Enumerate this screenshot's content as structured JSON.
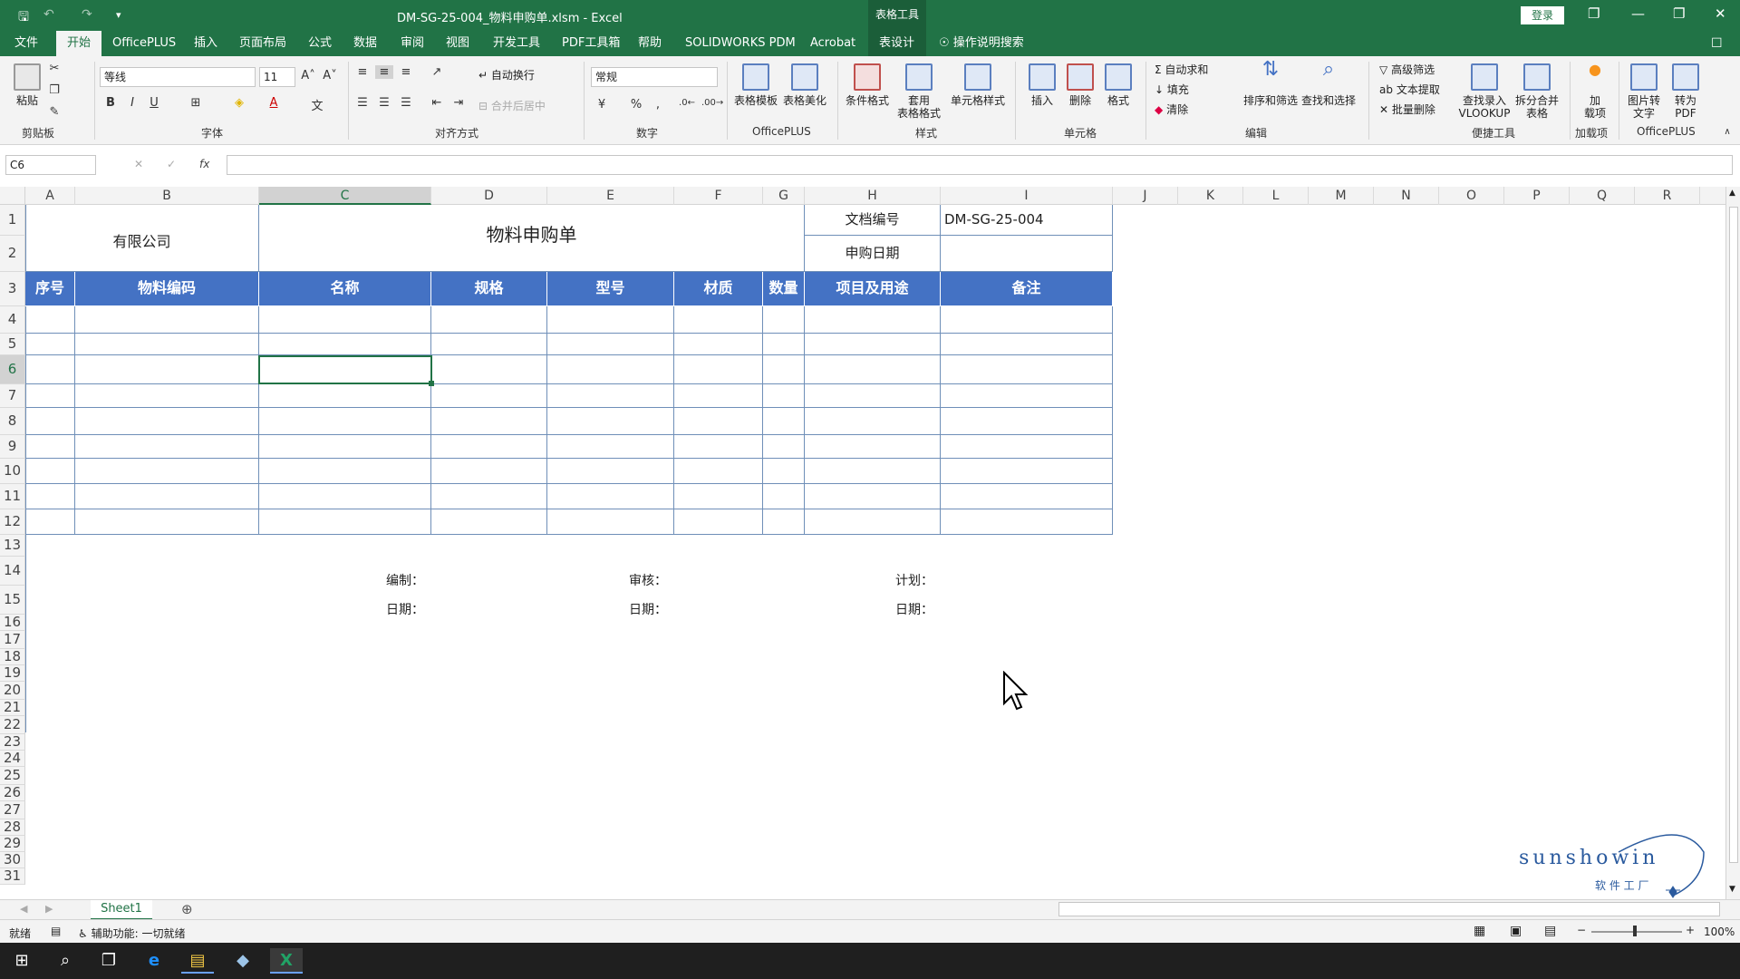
{
  "titlebar": {
    "doc_title": "DM-SG-25-004_物料申购单.xlsm  -  Excel",
    "context_tool": "表格工具",
    "login": "登录"
  },
  "tabs": [
    "文件",
    "开始",
    "OfficePLUS",
    "插入",
    "页面布局",
    "公式",
    "数据",
    "审阅",
    "视图",
    "开发工具",
    "PDF工具箱",
    "帮助",
    "SOLIDWORKS PDM",
    "Acrobat",
    "表设计"
  ],
  "active_tab": "开始",
  "search_tab": "操作说明搜索",
  "ribbon": {
    "clipboard": {
      "paste": "粘贴",
      "label": "剪贴板"
    },
    "font": {
      "name": "等线",
      "size": "11",
      "label": "字体"
    },
    "alignment": {
      "wrap": "自动换行",
      "merge": "合并后居中",
      "label": "对齐方式"
    },
    "number": {
      "format": "常规",
      "percent": "%",
      "comma": ",",
      "label": "数字"
    },
    "officeplus1": {
      "tpl": "表格模板",
      "beautify": "表格美化",
      "label": "OfficePLUS"
    },
    "styles": {
      "cond": "条件格式",
      "table_fmt_1": "套用",
      "table_fmt_2": "表格格式",
      "cell_style": "单元格样式",
      "label": "样式"
    },
    "cells": {
      "insert": "插入",
      "delete": "删除",
      "format": "格式",
      "label": "单元格"
    },
    "editing": {
      "autosum": "自动求和",
      "fill": "填充",
      "clear": "清除",
      "sort": "排序和筛选",
      "find": "查找和选择",
      "label": "编辑"
    },
    "tools": {
      "adv_filter": "高级筛选",
      "text_extract": "文本提取",
      "batch_delete": "批量删除",
      "vlookup_1": "查找录入",
      "vlookup_2": "VLOOKUP",
      "split_1": "拆分合并",
      "split_2": "表格",
      "label": "便捷工具"
    },
    "addins": {
      "addin_1": "加",
      "addin_2": "载项",
      "label": "加载项"
    },
    "officeplus2": {
      "img2txt_1": "图片转",
      "img2txt_2": "文字",
      "topdf_1": "转为",
      "topdf_2": "PDF",
      "label": "OfficePLUS"
    }
  },
  "namebox": "C6",
  "fx": "fx",
  "columns": [
    "A",
    "B",
    "C",
    "D",
    "E",
    "F",
    "G",
    "H",
    "I",
    "J",
    "K",
    "L",
    "M",
    "N",
    "O",
    "P",
    "Q",
    "R"
  ],
  "rows": [
    "1",
    "2",
    "3",
    "4",
    "5",
    "6",
    "7",
    "8",
    "9",
    "10",
    "11",
    "12",
    "13",
    "14",
    "15",
    "16",
    "17",
    "18",
    "19",
    "20",
    "21",
    "22",
    "23",
    "24",
    "25",
    "26",
    "27",
    "28",
    "29",
    "30",
    "31"
  ],
  "sheet": {
    "company": "有限公司",
    "title": "物料申购单",
    "doc_no_label": "文档编号",
    "doc_no": "DM-SG-25-004",
    "date_label": "申购日期",
    "headers": [
      "序号",
      "物料编码",
      "名称",
      "规格",
      "型号",
      "材质",
      "数量",
      "项目及用途",
      "备注"
    ],
    "sign": {
      "compile": "编制：",
      "review": "审核：",
      "plan": "计划：",
      "date1": "日期：",
      "date2": "日期：",
      "date3": "日期："
    }
  },
  "sheet_tab": "Sheet1",
  "status": {
    "ready": "就绪",
    "accessibility": "辅助功能: 一切就绪",
    "zoom": "100%"
  },
  "logo": {
    "brand": "sunshowin",
    "sub": "软 件 工 厂"
  },
  "colors": {
    "excel_green": "#217346",
    "header_blue": "#4472c4"
  }
}
